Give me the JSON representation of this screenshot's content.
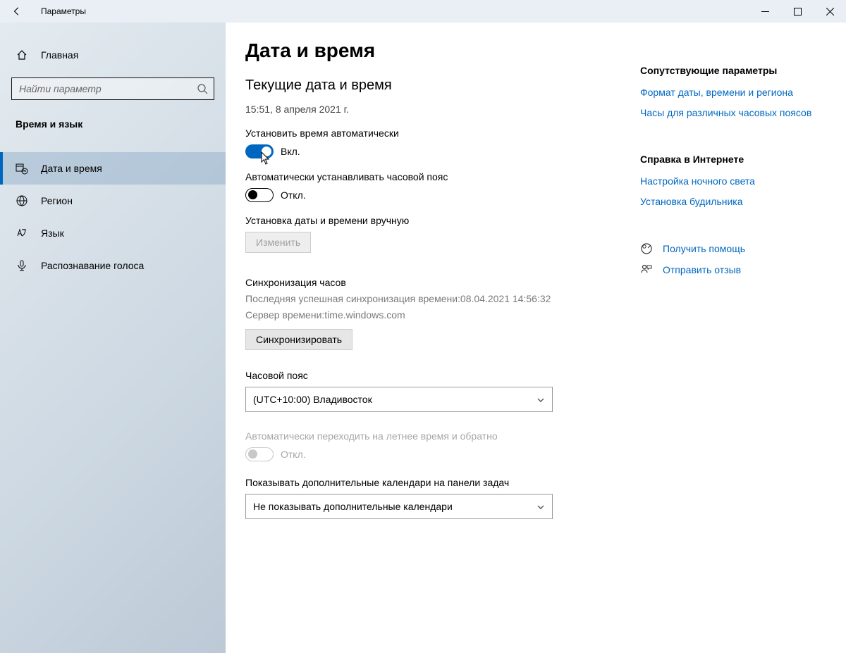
{
  "window": {
    "title": "Параметры"
  },
  "sidebar": {
    "home": "Главная",
    "search_placeholder": "Найти параметр",
    "category": "Время и язык",
    "items": [
      {
        "label": "Дата и время"
      },
      {
        "label": "Регион"
      },
      {
        "label": "Язык"
      },
      {
        "label": "Распознавание голоса"
      }
    ]
  },
  "main": {
    "title": "Дата и время",
    "section_current": "Текущие дата и время",
    "current_datetime": "15:51, 8 апреля 2021 г.",
    "auto_time_label": "Установить время автоматически",
    "auto_time_state": "Вкл.",
    "auto_tz_label": "Автоматически устанавливать часовой пояс",
    "auto_tz_state": "Откл.",
    "manual_label": "Установка даты и времени вручную",
    "manual_button": "Изменить",
    "sync_heading": "Синхронизация часов",
    "sync_last": "Последняя успешная синхронизация времени:08.04.2021 14:56:32",
    "sync_server": "Сервер времени:time.windows.com",
    "sync_button": "Синхронизировать",
    "tz_label": "Часовой пояс",
    "tz_value": "(UTC+10:00) Владивосток",
    "dst_label": "Автоматически переходить на летнее время и обратно",
    "dst_state": "Откл.",
    "extra_cal_label": "Показывать дополнительные календари на панели задач",
    "extra_cal_value": "Не показывать дополнительные календари"
  },
  "related": {
    "heading1": "Сопутствующие параметры",
    "link1": "Формат даты, времени и региона",
    "link2": "Часы для различных часовых поясов",
    "heading2": "Справка в Интернете",
    "link3": "Настройка ночного света",
    "link4": "Установка будильника",
    "help": "Получить помощь",
    "feedback": "Отправить отзыв"
  }
}
